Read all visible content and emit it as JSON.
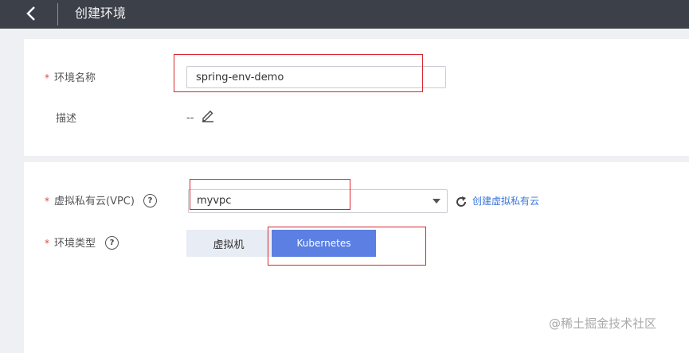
{
  "header": {
    "title": "创建环境"
  },
  "form": {
    "env_name": {
      "label": "环境名称",
      "value": "spring-env-demo"
    },
    "description": {
      "label": "描述",
      "value": "--"
    },
    "vpc": {
      "label": "虚拟私有云(VPC)",
      "value": "myvpc",
      "create_link": "创建虚拟私有云"
    },
    "env_type": {
      "label": "环境类型",
      "options": [
        "虚拟机",
        "Kubernetes"
      ],
      "selected": "Kubernetes"
    }
  },
  "required_mark": "*",
  "help_glyph": "?",
  "watermark": "@稀土掘金技术社区",
  "colors": {
    "accent": "#5b7fe2",
    "link": "#3a76d8",
    "required": "#e04646",
    "highlight": "#d9262c",
    "topbar": "#3b4049"
  },
  "icons": [
    "back-arrow",
    "edit-pencil",
    "dropdown-caret",
    "refresh",
    "help-circle"
  ]
}
